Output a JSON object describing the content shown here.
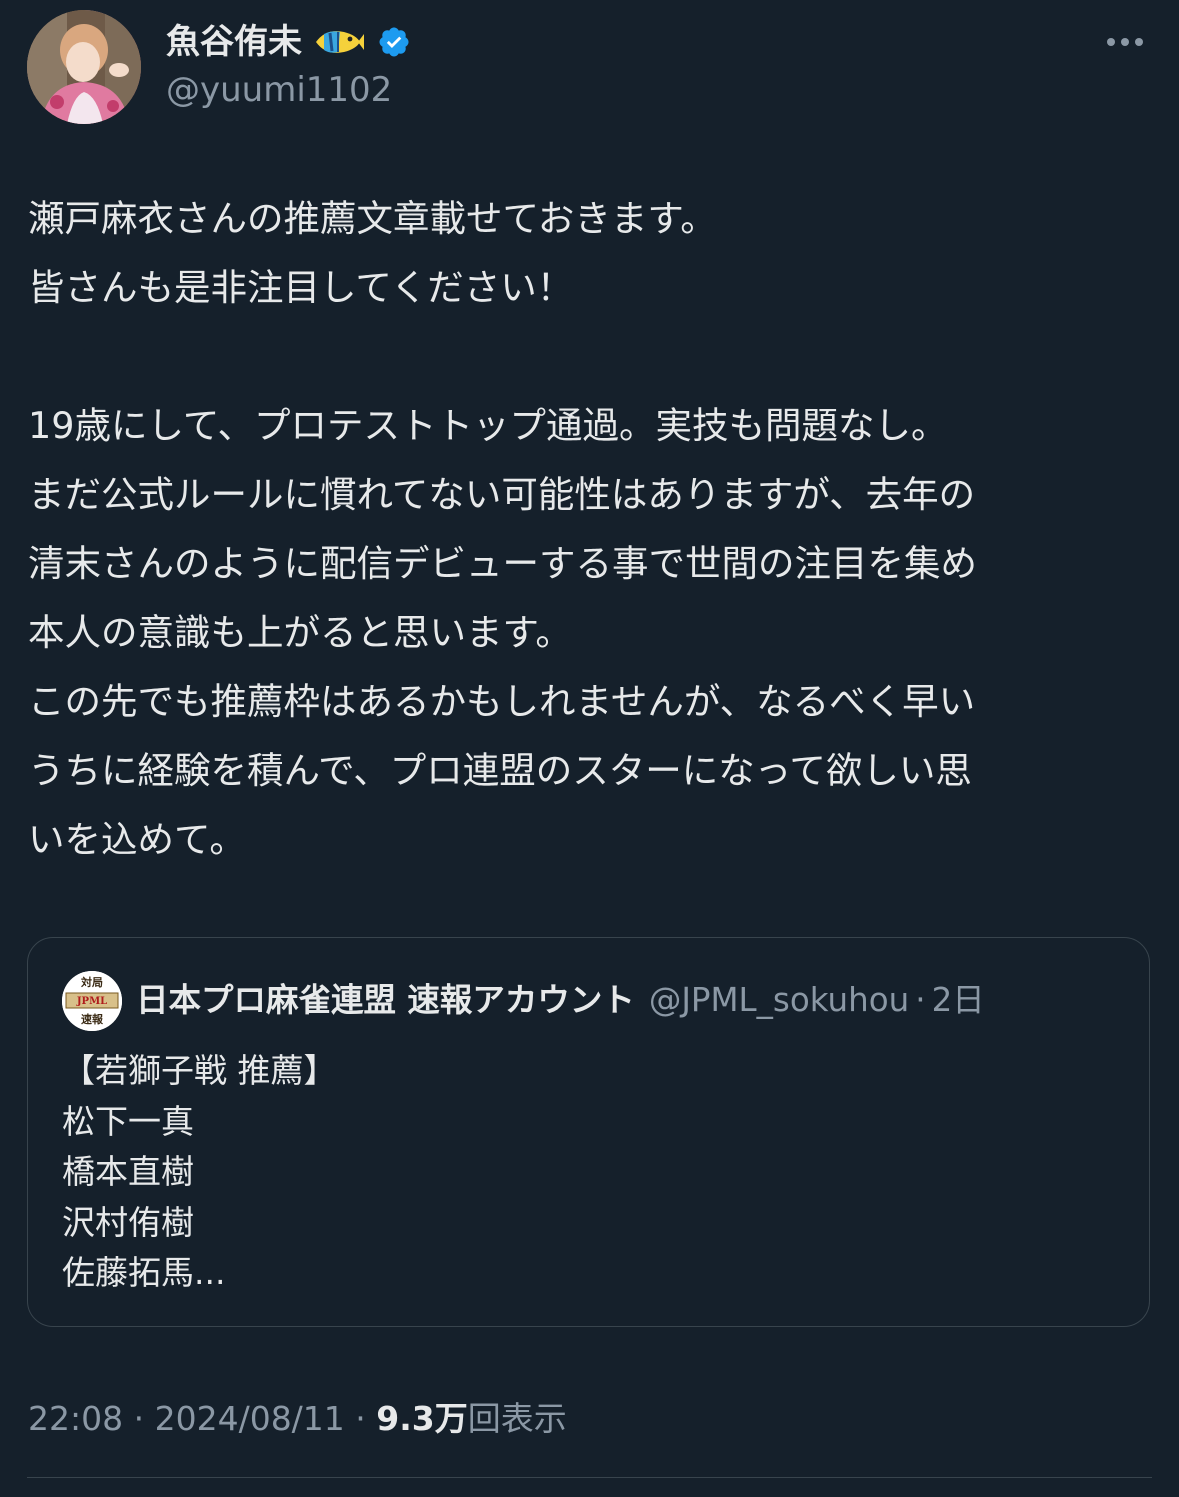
{
  "author": {
    "display_name": "魚谷侑未",
    "handle": "@yuumi1102",
    "name_emoji_icon": "tropical-fish-icon",
    "verified_icon": "verified-badge-icon",
    "verified_color": "#1d9bf0"
  },
  "more_icon": "more-horizontal-icon",
  "tweet": {
    "lines": [
      "瀬戸麻衣さんの推薦文章載せておきます。",
      "皆さんも是非注目してください！",
      "",
      "19歳にして、プロテストトップ通過。実技も問題なし。",
      "まだ公式ルールに慣れてない可能性はありますが、去年の",
      "清末さんのように配信デビューする事で世間の注目を集め",
      "本人の意識も上がると思います。",
      "この先でも推薦枠はあるかもしれませんが、なるべく早い",
      "うちに経験を積んで、プロ連盟のスターになって欲しい思",
      "いを込めて。"
    ]
  },
  "quote": {
    "name": "日本プロ麻雀連盟 速報アカウント",
    "handle": "@JPML_sokuhou",
    "separator": "·",
    "time": "2日",
    "avatar_logo_text": "JPML 対局 速報",
    "lines": [
      "【若獅子戦 推薦】",
      "松下一真",
      "橋本直樹",
      "沢村侑樹",
      "佐藤拓馬..."
    ]
  },
  "meta": {
    "time": "22:08",
    "sep1": " · ",
    "date": "2024/08/11",
    "sep2": " · ",
    "views_count": "9.3万",
    "views_label": "回表示"
  },
  "colors": {
    "background": "#15202b",
    "text_primary": "#e7e9ea",
    "text_secondary": "#8b98a5",
    "border": "#38444d"
  }
}
